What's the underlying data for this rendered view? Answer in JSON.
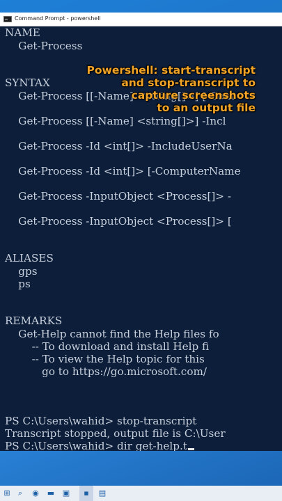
{
  "window": {
    "title": "Command Prompt - powershell"
  },
  "console": {
    "lines": [
      "NAME",
      "    Get-Process",
      "SYNTAX",
      "    Get-Process [[-Name] <string[]>] [-Com",
      "    Get-Process [[-Name] <string[]>] -Incl",
      "    Get-Process -Id <int[]> -IncludeUserNa",
      "    Get-Process -Id <int[]> [-ComputerName",
      "    Get-Process -InputObject <Process[]> -",
      "    Get-Process -InputObject <Process[]> [",
      "ALIASES",
      "    gps",
      "    ps",
      "REMARKS",
      "    Get-Help cannot find the Help files fo",
      "        -- To download and install Help fi",
      "        -- To view the Help topic for this",
      "           go to https://go.microsoft.com/",
      "PS C:\\Users\\wahid> stop-transcript",
      "Transcript stopped, output file is C:\\User",
      "PS C:\\Users\\wahid> dir get-help.t"
    ]
  },
  "caption": {
    "lines": [
      "Powershell: start-transcript",
      "and stop-transcript to",
      "capture screenshots",
      "to an output file"
    ],
    "color": "#f0a326"
  },
  "taskbar": {
    "icons": [
      "start-icon",
      "search-icon",
      "edge-icon",
      "explorer-icon",
      "store-icon",
      "mail-icon",
      "terminal-icon",
      "app-icon"
    ]
  }
}
